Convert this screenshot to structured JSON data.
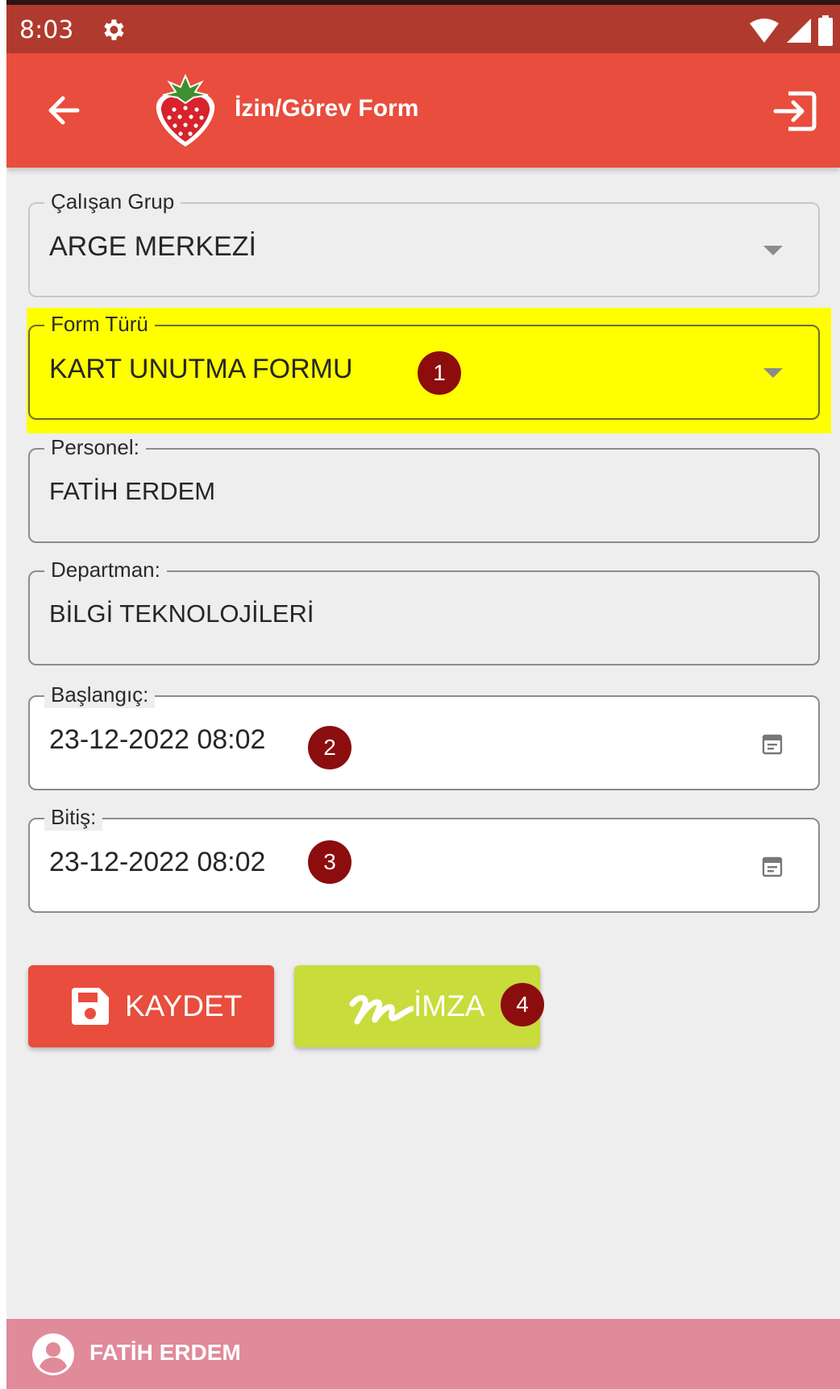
{
  "status_bar": {
    "time": "8:03"
  },
  "app_bar": {
    "title": "İzin/Görev Form"
  },
  "form": {
    "employee_group": {
      "label": "Çalışan Grup",
      "value": "ARGE MERKEZİ"
    },
    "form_type": {
      "label": "Form Türü",
      "value": "KART UNUTMA FORMU",
      "badge": "1"
    },
    "personnel": {
      "label": "Personel:",
      "value": "FATİH ERDEM"
    },
    "department": {
      "label": "Departman:",
      "value": "BİLGİ TEKNOLOJİLERİ"
    },
    "start": {
      "label": "Başlangıç:",
      "value": "23-12-2022 08:02",
      "badge": "2"
    },
    "end": {
      "label": "Bitiş:",
      "value": "23-12-2022 08:02",
      "badge": "3"
    }
  },
  "buttons": {
    "save": {
      "label": "KAYDET",
      "color": "#e84d3d"
    },
    "sign": {
      "label": "İMZA",
      "badge": "4",
      "color": "#c8dc3c"
    }
  },
  "footer": {
    "user_name": "FATİH ERDEM"
  },
  "colors": {
    "primary": "#e84d3d",
    "status_bar": "#b03a2d",
    "highlight": "#ffff00",
    "badge": "#8c0d0d",
    "footer": "#e08a9a"
  }
}
